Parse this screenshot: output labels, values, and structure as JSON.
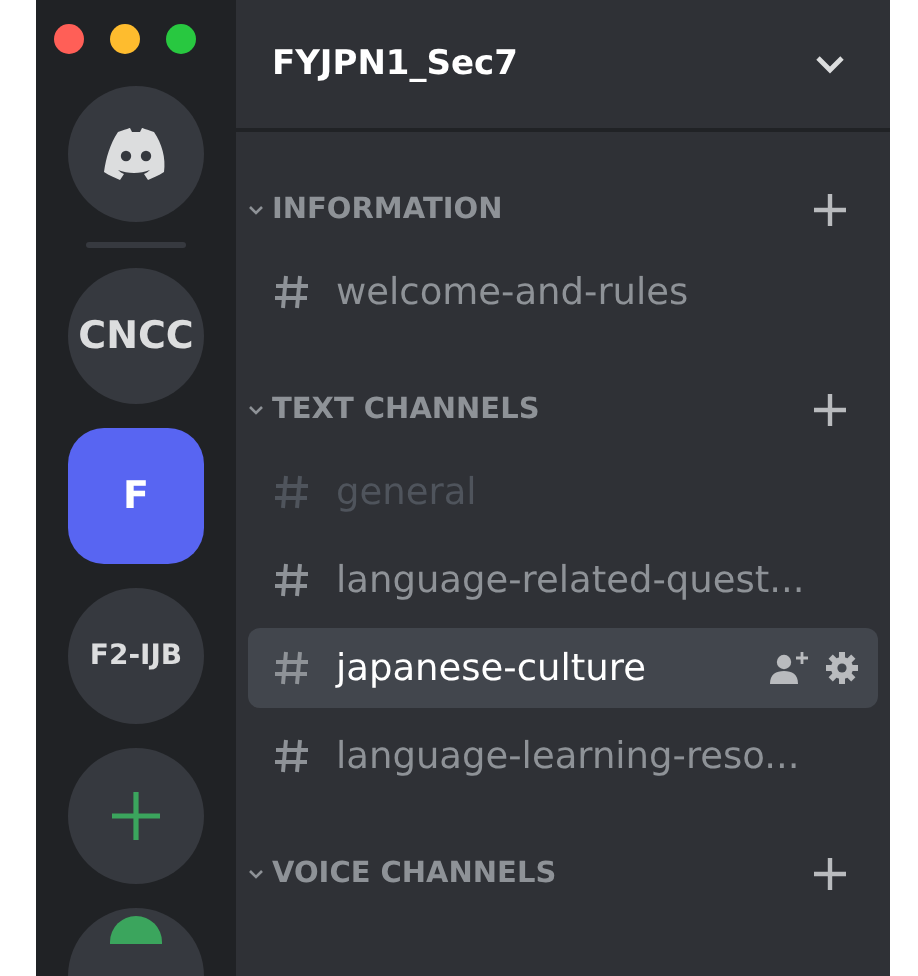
{
  "servers": [
    {
      "kind": "home",
      "selected": false
    },
    {
      "kind": "divider"
    },
    {
      "kind": "server",
      "label": "CNCC",
      "selected": false
    },
    {
      "kind": "server",
      "label": "F",
      "selected": true
    },
    {
      "kind": "server",
      "label": "F2-IJB",
      "selected": false
    },
    {
      "kind": "add",
      "selected": false
    },
    {
      "kind": "explore",
      "selected": false
    }
  ],
  "server_header": {
    "title": "FYJPN1_Sec7"
  },
  "categories": [
    {
      "name": "INFORMATION",
      "expanded": true,
      "channels": [
        {
          "name": "welcome-and-rules",
          "selected": false,
          "muted": false
        }
      ]
    },
    {
      "name": "TEXT CHANNELS",
      "expanded": true,
      "channels": [
        {
          "name": "general",
          "selected": false,
          "muted": true
        },
        {
          "name": "language-related-quest...",
          "selected": false,
          "muted": false
        },
        {
          "name": "japanese-culture",
          "selected": true,
          "muted": false
        },
        {
          "name": "language-learning-reso...",
          "selected": false,
          "muted": false
        }
      ]
    },
    {
      "name": "VOICE CHANNELS",
      "expanded": true
    }
  ]
}
